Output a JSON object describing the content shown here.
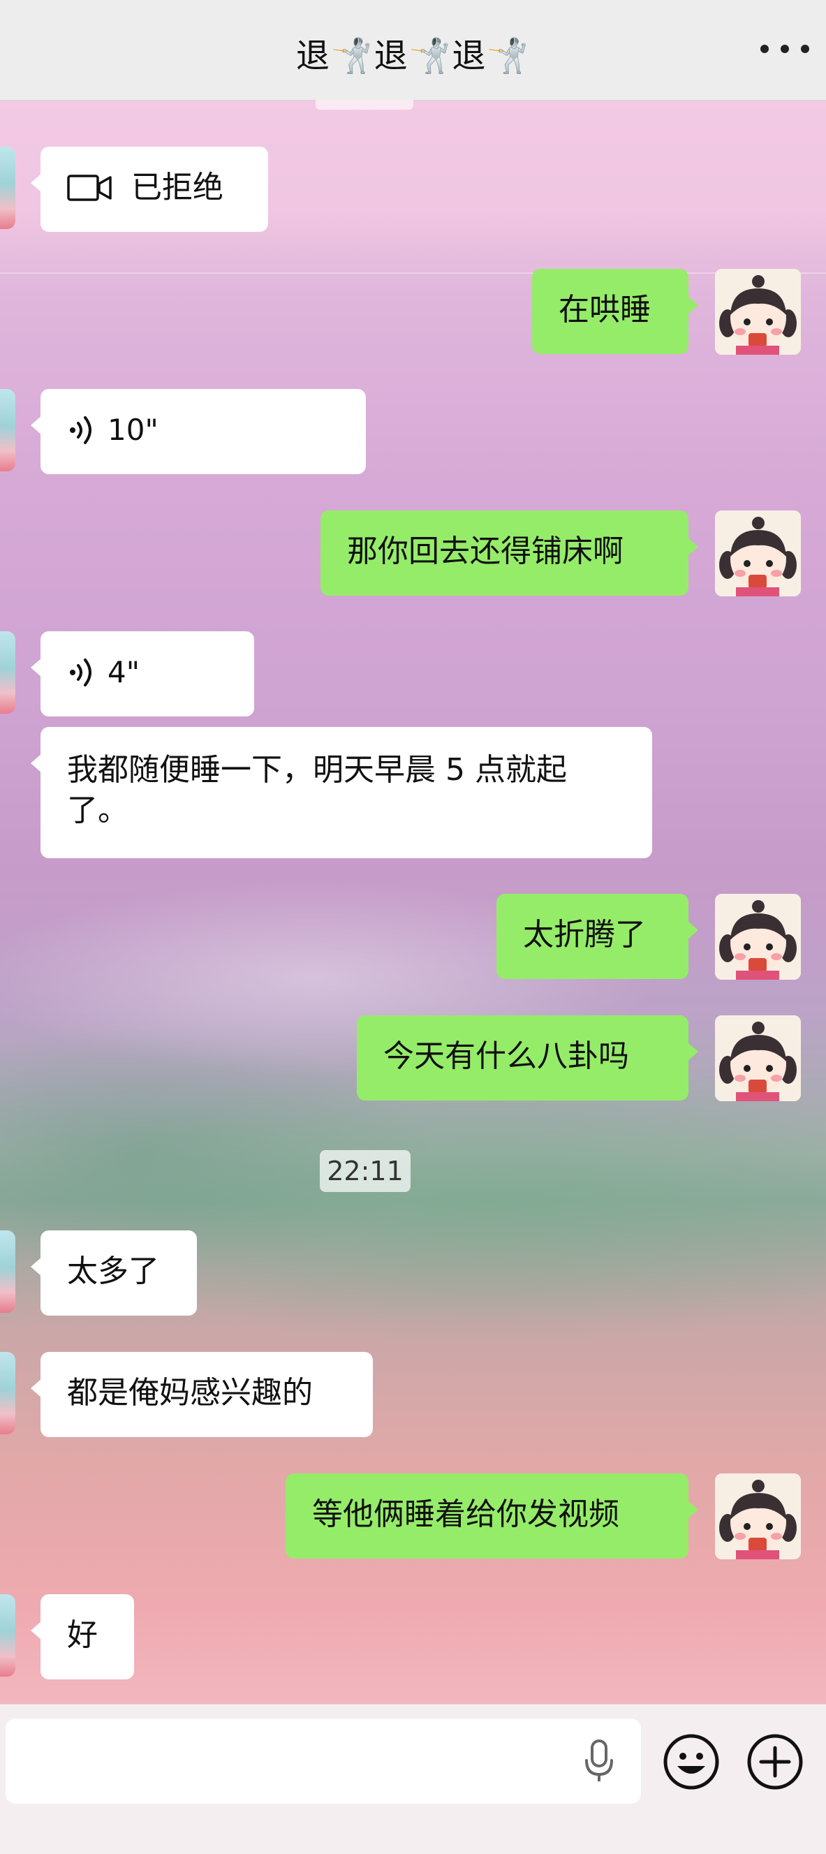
{
  "header": {
    "title": "退🤺退🤺退🤺"
  },
  "messages": [
    {
      "side": "in",
      "type": "video-call",
      "text": "已拒绝"
    },
    {
      "side": "out",
      "type": "text",
      "text": "在哄睡"
    },
    {
      "side": "in",
      "type": "voice",
      "duration": "10\""
    },
    {
      "side": "out",
      "type": "text",
      "text": "那你回去还得铺床啊"
    },
    {
      "side": "in",
      "type": "voice",
      "duration": "4\""
    },
    {
      "side": "in",
      "type": "text",
      "text": "我都随便睡一下，明天早晨 5 点就起了。"
    },
    {
      "side": "out",
      "type": "text",
      "text": "太折腾了"
    },
    {
      "side": "out",
      "type": "text",
      "text": "今天有什么八卦吗"
    },
    {
      "side": "in",
      "type": "text",
      "text": "太多了"
    },
    {
      "side": "in",
      "type": "text",
      "text": "都是俺妈感兴趣的"
    },
    {
      "side": "out",
      "type": "text",
      "text": "等他俩睡着给你发视频"
    },
    {
      "side": "in",
      "type": "text",
      "text": "好"
    }
  ],
  "timestamp": "22:11",
  "colors": {
    "outgoing_bubble": "#95ec69",
    "incoming_bubble": "#ffffff",
    "header_bg": "#ededed"
  },
  "icons": [
    "more-icon",
    "video-call-icon",
    "voice-icon",
    "microphone-icon",
    "emoji-icon",
    "plus-icon"
  ]
}
